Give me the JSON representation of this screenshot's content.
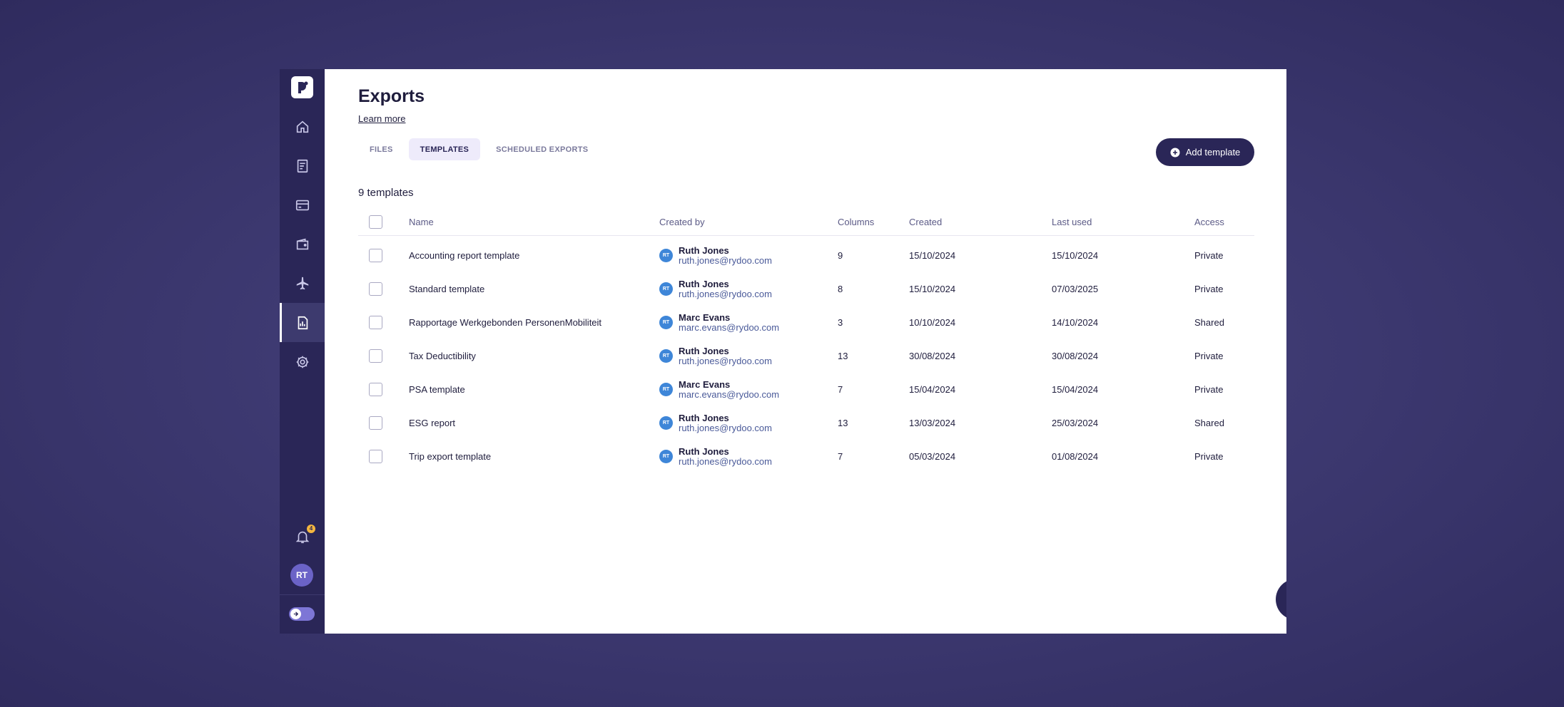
{
  "sidebar": {
    "logo_icon": "rydoo-logo-icon",
    "items": [
      {
        "name": "home",
        "icon": "home-icon",
        "active": false
      },
      {
        "name": "expenses",
        "icon": "receipt-icon",
        "active": false
      },
      {
        "name": "cards",
        "icon": "card-icon",
        "active": false
      },
      {
        "name": "wallet",
        "icon": "wallet-icon",
        "active": false
      },
      {
        "name": "travel",
        "icon": "plane-icon",
        "active": false
      },
      {
        "name": "reports",
        "icon": "report-icon",
        "active": true
      },
      {
        "name": "settings",
        "icon": "gear-icon",
        "active": false
      }
    ],
    "notifications_badge": "4",
    "user_initials": "RT"
  },
  "header": {
    "title": "Exports",
    "learn_more": "Learn more"
  },
  "tabs": [
    {
      "label": "FILES",
      "active": false
    },
    {
      "label": "TEMPLATES",
      "active": true
    },
    {
      "label": "SCHEDULED EXPORTS",
      "active": false
    }
  ],
  "add_button_label": "Add template",
  "count_label": "9 templates",
  "table": {
    "columns": [
      "Name",
      "Created by",
      "Columns",
      "Created",
      "Last used",
      "Access"
    ],
    "rows": [
      {
        "name": "Accounting report template",
        "initials": "RT",
        "creator": "Ruth Jones",
        "email": "ruth.jones@rydoo.com",
        "columns": "9",
        "created": "15/10/2024",
        "last_used": "15/10/2024",
        "access": "Private"
      },
      {
        "name": "Standard template",
        "initials": "RT",
        "creator": "Ruth Jones",
        "email": "ruth.jones@rydoo.com",
        "columns": "8",
        "created": "15/10/2024",
        "last_used": "07/03/2025",
        "access": "Private"
      },
      {
        "name": "Rapportage Werkgebonden PersonenMobiliteit",
        "initials": "RT",
        "creator": "Marc Evans",
        "email": "marc.evans@rydoo.com",
        "columns": "3",
        "created": "10/10/2024",
        "last_used": "14/10/2024",
        "access": "Shared"
      },
      {
        "name": "Tax Deductibility",
        "initials": "RT",
        "creator": "Ruth Jones",
        "email": "ruth.jones@rydoo.com",
        "columns": "13",
        "created": "30/08/2024",
        "last_used": "30/08/2024",
        "access": "Private"
      },
      {
        "name": "PSA template",
        "initials": "RT",
        "creator": "Marc Evans",
        "email": "marc.evans@rydoo.com",
        "columns": "7",
        "created": "15/04/2024",
        "last_used": "15/04/2024",
        "access": "Private"
      },
      {
        "name": "ESG report",
        "initials": "RT",
        "creator": "Ruth Jones",
        "email": "ruth.jones@rydoo.com",
        "columns": "13",
        "created": "13/03/2024",
        "last_used": "25/03/2024",
        "access": "Shared"
      },
      {
        "name": "Trip export template",
        "initials": "RT",
        "creator": "Ruth Jones",
        "email": "ruth.jones@rydoo.com",
        "columns": "7",
        "created": "05/03/2024",
        "last_used": "01/08/2024",
        "access": "Private"
      }
    ]
  },
  "chat_icon": "chat-bubble-icon"
}
